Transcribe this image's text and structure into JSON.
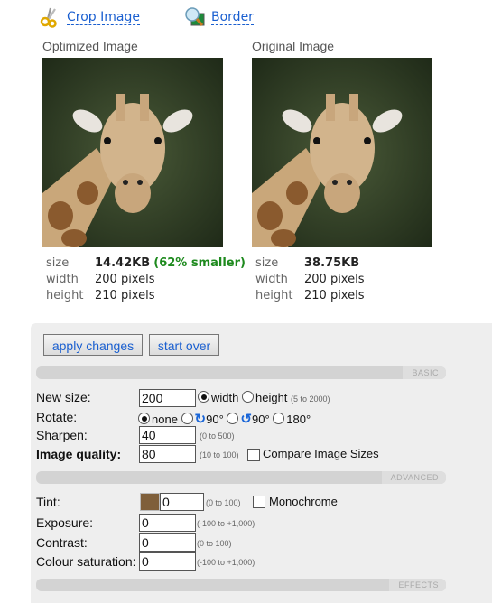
{
  "toolbar": {
    "crop": {
      "label": "Crop Image",
      "icon": "scissors-icon"
    },
    "border": {
      "label": "Border",
      "icon": "magnifier-picture-icon"
    }
  },
  "optimized": {
    "title": "Optimized Image",
    "size_label": "size",
    "size_value": "14.42KB",
    "size_note": "(62% smaller)",
    "width_label": "width",
    "width_value": "200 pixels",
    "height_label": "height",
    "height_value": "210 pixels"
  },
  "original": {
    "title": "Original Image",
    "size_label": "size",
    "size_value": "38.75KB",
    "width_label": "width",
    "width_value": "200 pixels",
    "height_label": "height",
    "height_value": "210 pixels"
  },
  "actions": {
    "apply": "apply changes",
    "start_over": "start over"
  },
  "sections": {
    "basic": "BASIC",
    "advanced": "ADVANCED",
    "effects": "EFFECTS"
  },
  "basic": {
    "new_size_label": "New size:",
    "new_size_value": "200",
    "dim_width": "width",
    "dim_height": "height",
    "dim_selected": "width",
    "new_size_hint": "(5 to 2000)",
    "rotate_label": "Rotate:",
    "rotate_options": [
      "none",
      "90°",
      "90°",
      "180°"
    ],
    "rotate_selected": "none",
    "sharpen_label": "Sharpen:",
    "sharpen_value": "40",
    "sharpen_hint": "(0 to 500)",
    "quality_label": "Image quality:",
    "quality_value": "80",
    "quality_hint": "(10 to 100)",
    "compare_label": "Compare Image Sizes",
    "compare_checked": false
  },
  "advanced": {
    "tint_label": "Tint:",
    "tint_color": "#7f5f3a",
    "tint_value": "0",
    "tint_hint": "(0 to 100)",
    "monochrome_label": "Monochrome",
    "monochrome_checked": false,
    "exposure_label": "Exposure:",
    "exposure_value": "0",
    "exposure_hint": "(-100 to +1,000)",
    "contrast_label": "Contrast:",
    "contrast_value": "0",
    "contrast_hint": "(0 to 100)",
    "saturation_label": "Colour saturation:",
    "saturation_value": "0",
    "saturation_hint": "(-100 to +1,000)"
  }
}
